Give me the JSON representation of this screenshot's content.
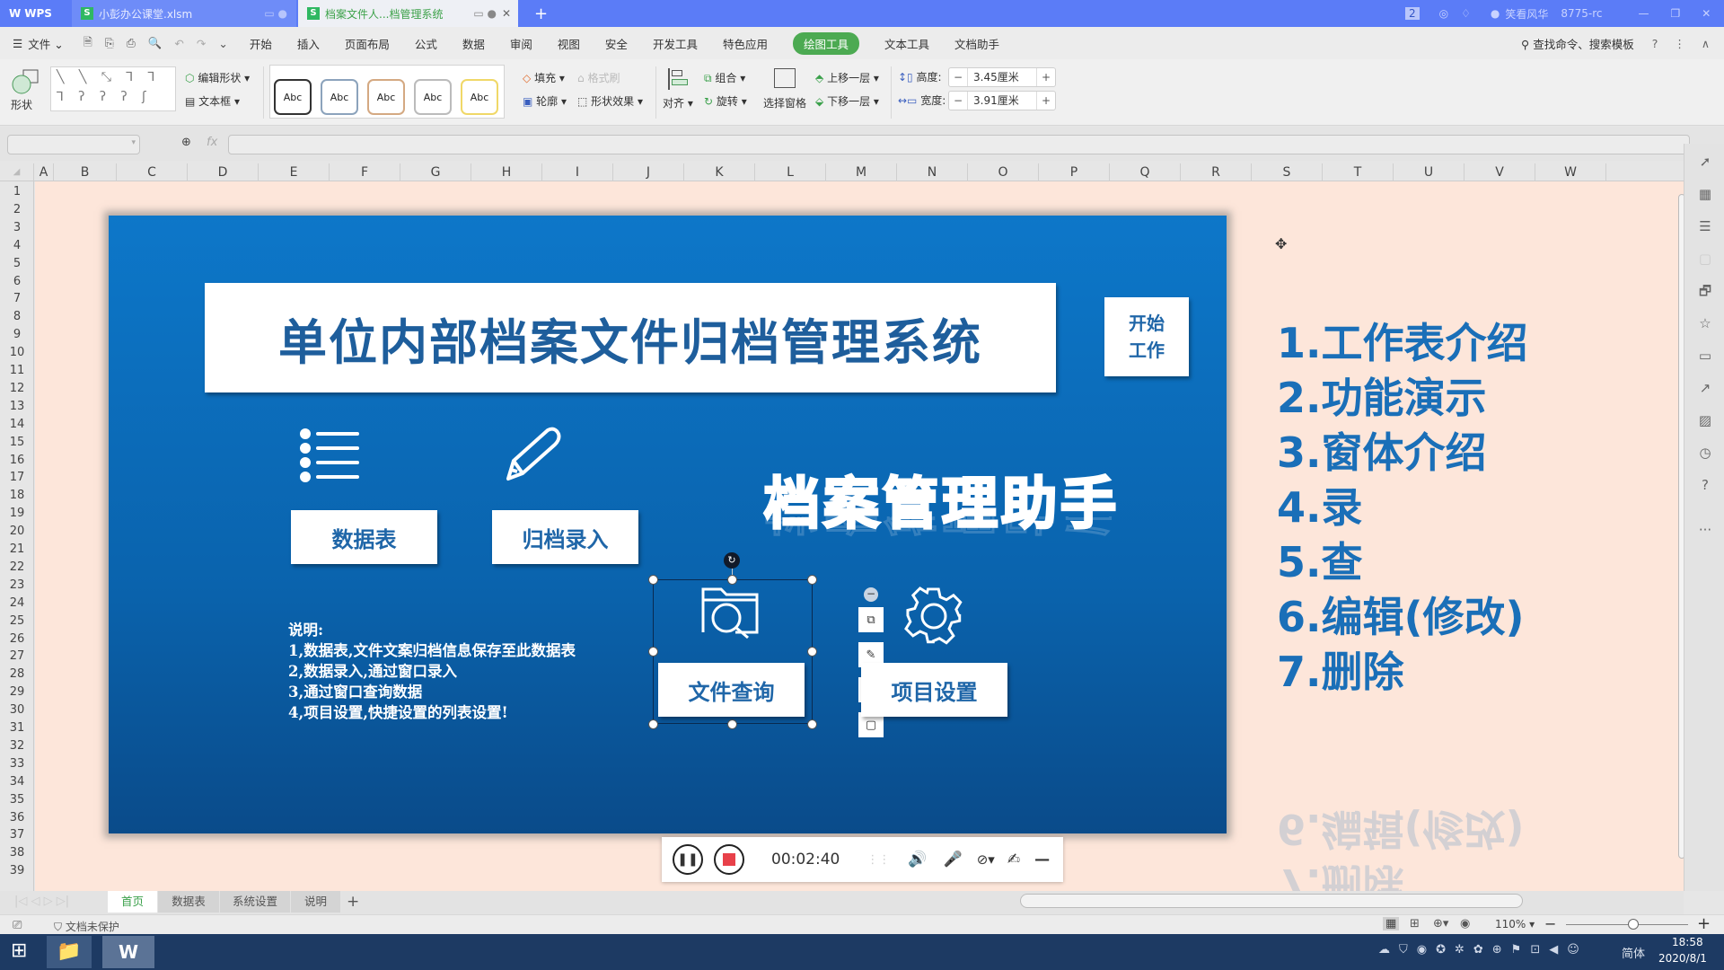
{
  "titlebar": {
    "app_label": "WPS",
    "tabs": [
      {
        "label": "小彭办公课堂.xlsm",
        "active": false
      },
      {
        "label": "档案文件人...档管理系统",
        "active": true
      }
    ],
    "new_tab": "+",
    "badge_count": "2",
    "user_name": "笑看风华",
    "user_id": "8775-rc"
  },
  "menubar": {
    "file_label": "文件",
    "items": [
      "开始",
      "插入",
      "页面布局",
      "公式",
      "数据",
      "审阅",
      "视图",
      "安全",
      "开发工具",
      "特色应用",
      "绘图工具",
      "文本工具",
      "文档助手"
    ],
    "active_item": "绘图工具",
    "search_label": "查找命令、搜索模板"
  },
  "ribbon": {
    "shape_label": "形状",
    "edit_shape": "编辑形状",
    "textbox": "文本框",
    "style_presets": [
      "Abc",
      "Abc",
      "Abc",
      "Abc",
      "Abc"
    ],
    "fill": "填充",
    "format_painter": "格式刷",
    "outline": "轮廓",
    "shape_effects": "形状效果",
    "align": "对齐",
    "group": "组合",
    "rotate": "旋转",
    "selection_pane": "选择窗格",
    "bring_forward": "上移一层",
    "send_backward": "下移一层",
    "height_label": "高度:",
    "height_value": "3.45厘米",
    "width_label": "宽度:",
    "width_value": "3.91厘米"
  },
  "formulabar": {
    "name_box": "",
    "fx_label": "fx",
    "formula": ""
  },
  "grid": {
    "columns": [
      "A",
      "B",
      "C",
      "D",
      "E",
      "F",
      "G",
      "H",
      "I",
      "J",
      "K",
      "L",
      "M",
      "N",
      "O",
      "P",
      "Q",
      "R",
      "S",
      "T",
      "U",
      "V",
      "W"
    ],
    "rows": [
      "1",
      "2",
      "3",
      "4",
      "5",
      "6",
      "7",
      "8",
      "9",
      "10",
      "11",
      "12",
      "13",
      "14",
      "15",
      "16",
      "17",
      "18",
      "19",
      "20",
      "21",
      "22",
      "23",
      "24",
      "25",
      "26",
      "27",
      "28",
      "29",
      "30",
      "31",
      "32",
      "33",
      "34",
      "35",
      "36",
      "37",
      "38",
      "39"
    ]
  },
  "slide": {
    "title": "单位内部档案文件归档管理系统",
    "start_button": [
      "开始",
      "工作"
    ],
    "assistant_text": "档案管理助手",
    "buttons": {
      "datasheet": "数据表",
      "archive_entry": "归档录入",
      "file_query": "文件查询",
      "project_settings": "项目设置"
    },
    "description": [
      "说明:",
      "1,数据表,文件文案归档信息保存至此数据表",
      "2,数据录入,通过窗口录入",
      "3,通过窗口查询数据",
      "4,项目设置,快捷设置的列表设置!"
    ]
  },
  "toc": [
    "1.工作表介绍",
    "2.功能演示",
    "3.窗体介绍",
    "4.录",
    "5.查",
    "6.编辑(修改)",
    "7.删除"
  ],
  "recorder": {
    "elapsed": "00:02:40"
  },
  "sheet_tabs": [
    {
      "label": "首页",
      "active": true
    },
    {
      "label": "数据表",
      "active": false
    },
    {
      "label": "系统设置",
      "active": false
    },
    {
      "label": "说明",
      "active": false
    }
  ],
  "statusbar": {
    "protection": "文档未保护",
    "zoom": "110%",
    "zoom_fraction": 0.55
  },
  "taskbar": {
    "ime": "简体",
    "time": "18:58",
    "date": "2020/8/1"
  },
  "colors": {
    "titlebar": "#5b7cf7",
    "active_menu": "#4caa52",
    "slide_blue": "#0d77c9",
    "sheet_bg": "#fde6da",
    "toc_text": "#1a6fb8"
  }
}
